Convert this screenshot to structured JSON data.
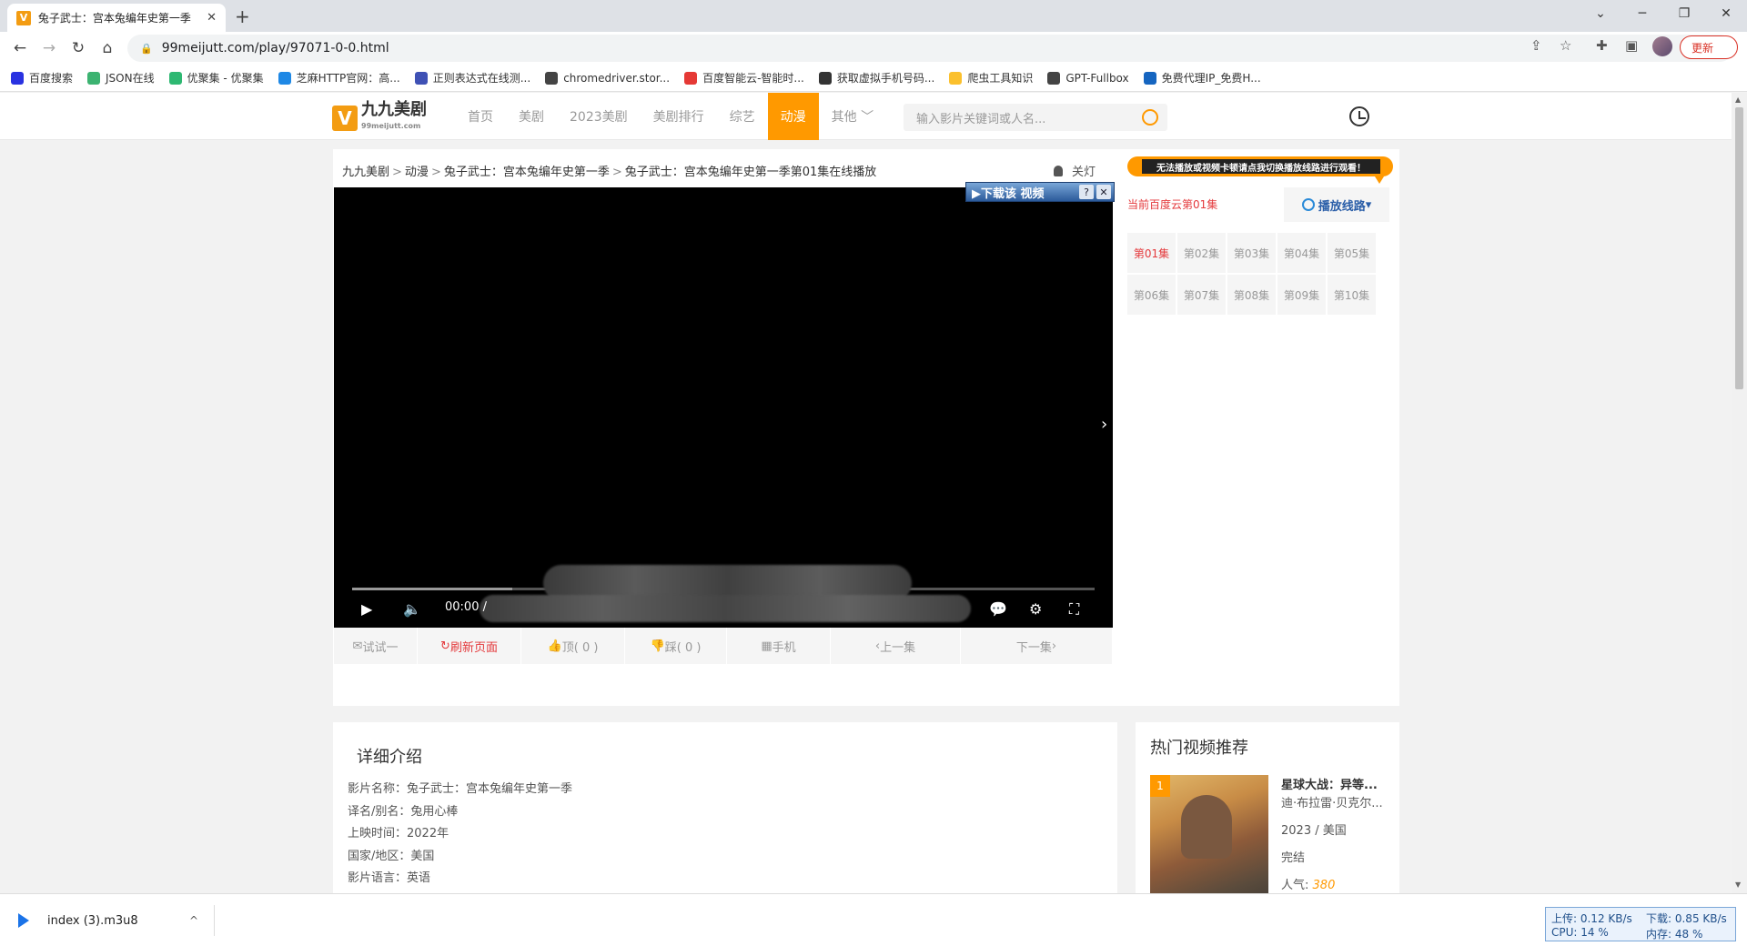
{
  "browser": {
    "tab_title": "兔子武士：宫本兔编年史第一季",
    "tab_close": "✕",
    "new_tab": "+",
    "url": "99meijutt.com/play/97071-0-0.html",
    "update_label": "更新",
    "bookmarks": [
      {
        "label": "百度搜索",
        "color": "#2932e1"
      },
      {
        "label": "JSON在线",
        "color": "#3cb371"
      },
      {
        "label": "优聚集 - 优聚集",
        "color": "#2eb872"
      },
      {
        "label": "芝麻HTTP官网：高...",
        "color": "#1e88e5"
      },
      {
        "label": "正则表达式在线测...",
        "color": "#3f51b5"
      },
      {
        "label": "chromedriver.stor...",
        "color": "#444444"
      },
      {
        "label": "百度智能云-智能时...",
        "color": "#e53935"
      },
      {
        "label": "获取虚拟手机号码...",
        "color": "#333333"
      },
      {
        "label": "爬虫工具知识",
        "color": "#fbc02d"
      },
      {
        "label": "GPT-Fullbox",
        "color": "#444444"
      },
      {
        "label": "免费代理IP_免费H...",
        "color": "#1565c0"
      }
    ]
  },
  "site": {
    "logo_mark": "V",
    "logo_text": "九九美剧",
    "logo_sub": "99meijutt.com",
    "nav": [
      "首页",
      "美剧",
      "2023美剧",
      "美剧排行",
      "综艺",
      "动漫",
      "其他 ﹀"
    ],
    "active_nav": "动漫",
    "search_placeholder": "输入影片关键词或人名...",
    "accent": "#ff9900"
  },
  "breadcrumb": {
    "items": [
      "九九美剧",
      "动漫",
      "兔子武士：宫本兔编年史第一季",
      "兔子武士：宫本兔编年史第一季第01集在线播放"
    ],
    "separator": ">"
  },
  "lights_off": "关灯",
  "player": {
    "download_badge": "▶下载该 视频",
    "help": "?",
    "close": "✕",
    "time": "00:00 /",
    "next_arrow": "›"
  },
  "actions": {
    "try": "试试一",
    "refresh": "刷新页面",
    "up": "顶( 0 )",
    "down": "踩( 0 )",
    "mobile": "手机",
    "prev": "上一集",
    "next": "下一集"
  },
  "sidebar": {
    "route_banner": "无法播放或视频卡顿请点我切换播放线路进行观看！",
    "current": "当前百度云第01集",
    "route_button": "播放线路",
    "episodes": [
      "第01集",
      "第02集",
      "第03集",
      "第04集",
      "第05集",
      "第06集",
      "第07集",
      "第08集",
      "第09集",
      "第10集"
    ],
    "current_index": 0
  },
  "detail": {
    "heading": "详细介绍",
    "rows": [
      "影片名称：兔子武士：宫本兔编年史第一季",
      "译名/别名：兔用心棒",
      "上映时间：2022年",
      "国家/地区：美国",
      "影片语言：英语"
    ]
  },
  "hot": {
    "heading": "热门视频推荐",
    "item": {
      "rank": "1",
      "title": "星球大战：异等...",
      "cast": "迪·布拉雷·贝克尔...",
      "meta": "2023 / 美国",
      "status": "完结",
      "popularity_label": "人气:",
      "popularity": "380"
    }
  },
  "download": {
    "filename": "index (3).m3u8",
    "chevron": "^"
  },
  "netmon": {
    "upload": "上传: 0.12 KB/s",
    "download": "下载: 0.85 KB/s",
    "cpu": "CPU: 14 %",
    "mem": "内存: 48 %"
  }
}
